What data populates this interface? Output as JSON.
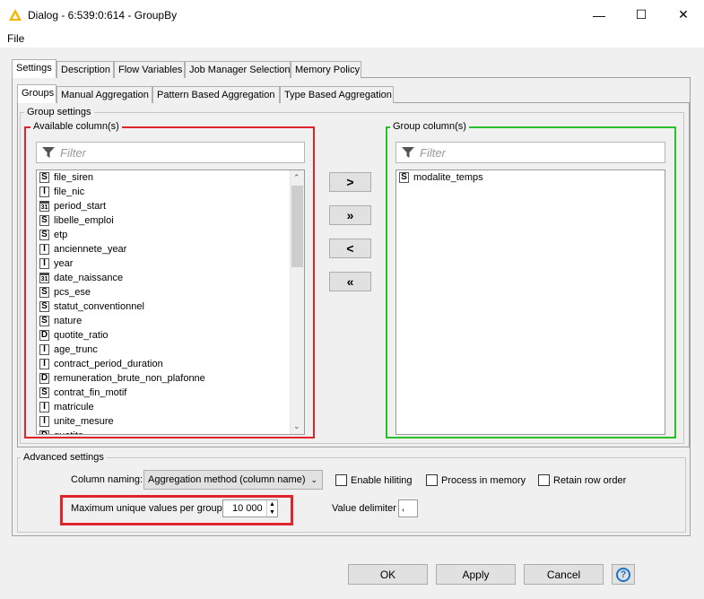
{
  "window": {
    "title": "Dialog - 6:539:0:614 - GroupBy",
    "minimize": "—",
    "maximize": "☐",
    "close": "✕"
  },
  "menu": {
    "file": "File"
  },
  "tabs": [
    "Settings",
    "Description",
    "Flow Variables",
    "Job Manager Selection",
    "Memory Policy"
  ],
  "subtabs": [
    "Groups",
    "Manual Aggregation",
    "Pattern Based Aggregation",
    "Type Based Aggregation"
  ],
  "group_settings": {
    "legend": "Group settings",
    "available": {
      "legend": "Available column(s)",
      "filter_placeholder": "Filter",
      "columns": [
        {
          "type": "S",
          "name": "file_siren"
        },
        {
          "type": "I",
          "name": "file_nic"
        },
        {
          "type": "31",
          "name": "period_start"
        },
        {
          "type": "S",
          "name": "libelle_emploi"
        },
        {
          "type": "S",
          "name": "etp"
        },
        {
          "type": "I",
          "name": "anciennete_year"
        },
        {
          "type": "I",
          "name": "year"
        },
        {
          "type": "31",
          "name": "date_naissance"
        },
        {
          "type": "S",
          "name": "pcs_ese"
        },
        {
          "type": "S",
          "name": "statut_conventionnel"
        },
        {
          "type": "S",
          "name": "nature"
        },
        {
          "type": "D",
          "name": "quotite_ratio"
        },
        {
          "type": "I",
          "name": "age_trunc"
        },
        {
          "type": "I",
          "name": "contract_period_duration"
        },
        {
          "type": "D",
          "name": "remuneration_brute_non_plafonne"
        },
        {
          "type": "S",
          "name": "contrat_fin_motif"
        },
        {
          "type": "I",
          "name": "matricule"
        },
        {
          "type": "I",
          "name": "unite_mesure"
        },
        {
          "type": "D",
          "name": "quotite"
        }
      ]
    },
    "move_buttons": [
      ">",
      "»",
      "<",
      "«"
    ],
    "group": {
      "legend": "Group column(s)",
      "filter_placeholder": "Filter",
      "columns": [
        {
          "type": "S",
          "name": "modalite_temps"
        }
      ]
    }
  },
  "advanced": {
    "legend": "Advanced settings",
    "column_naming_label": "Column naming:",
    "column_naming_value": "Aggregation method (column name)",
    "enable_hiliting": "Enable hiliting",
    "process_in_memory": "Process in memory",
    "retain_row_order": "Retain row order",
    "max_unique_label": "Maximum unique values per group",
    "max_unique_value": "10 000",
    "value_delimiter_label": "Value delimiter",
    "value_delimiter_value": ","
  },
  "buttons": {
    "ok": "OK",
    "apply": "Apply",
    "cancel": "Cancel",
    "help": "?"
  },
  "colors": {
    "highlight_red": "#e0242b",
    "highlight_green": "#2ac02a",
    "help_blue": "#1a73c9"
  }
}
